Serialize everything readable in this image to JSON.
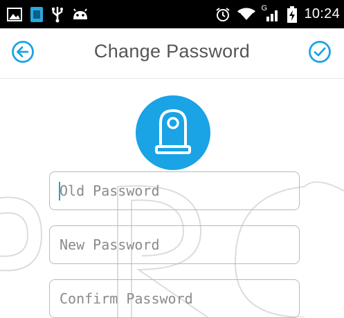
{
  "status_bar": {
    "time": "10:24",
    "network_label": "G",
    "icons": [
      "gallery-icon",
      "sim-app-icon",
      "usb-icon",
      "android-icon",
      "alarm-icon",
      "wifi-icon",
      "signal-icon",
      "battery-charging-icon"
    ]
  },
  "header": {
    "title": "Change Password",
    "back_icon": "arrow-left-circle-icon",
    "confirm_icon": "check-circle-icon"
  },
  "avatar": {
    "icon": "camera-device-icon",
    "color": "#1aa3e5"
  },
  "form": {
    "old_password": {
      "placeholder": "Old Password",
      "value": ""
    },
    "new_password": {
      "placeholder": "New Password",
      "value": ""
    },
    "confirm_password": {
      "placeholder": "Confirm Password",
      "value": ""
    }
  },
  "colors": {
    "accent": "#1aa3e5",
    "title_text": "#555555",
    "field_border": "#b9b9b9"
  }
}
